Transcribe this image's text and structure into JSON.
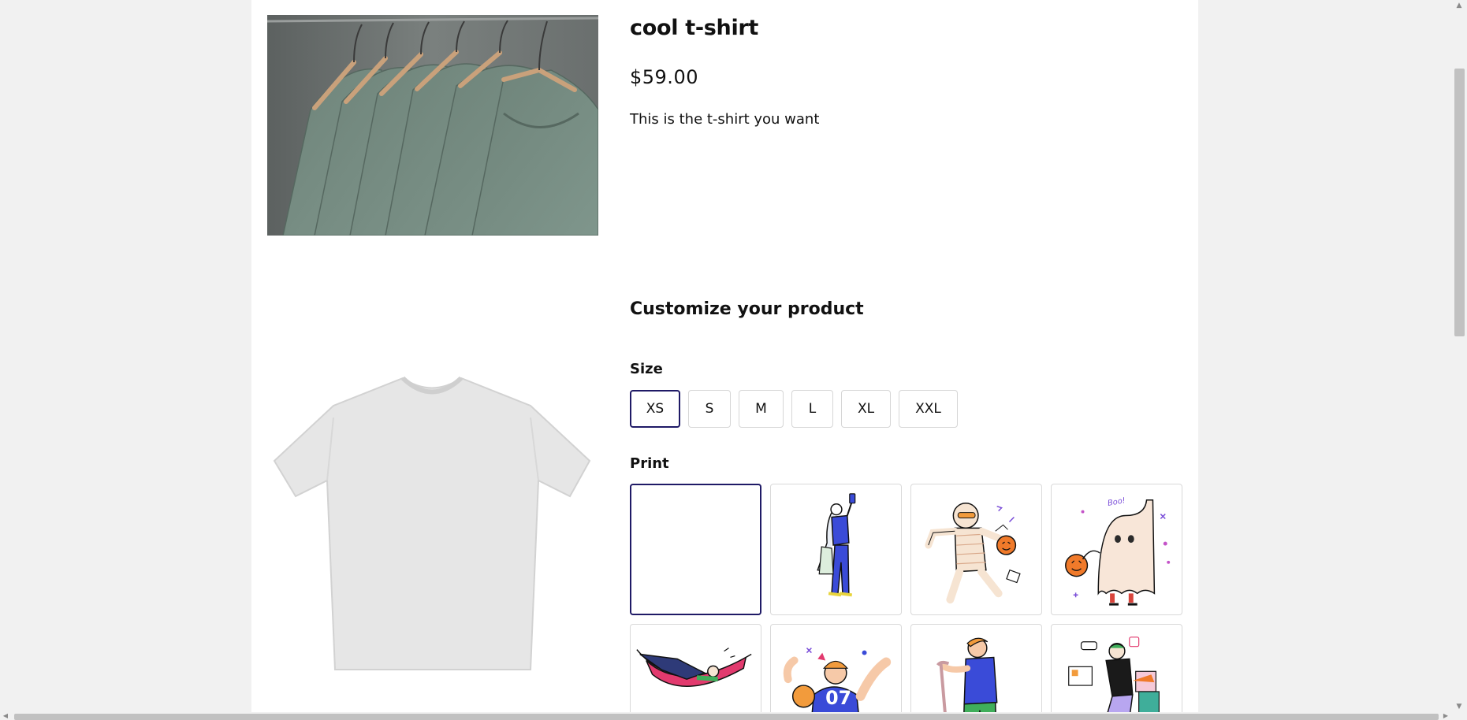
{
  "product": {
    "title": "cool t-shirt",
    "price": "$59.00",
    "description": "This is the t-shirt you want"
  },
  "customize": {
    "heading": "Customize your product",
    "size": {
      "label": "Size",
      "selected": "XS",
      "options": [
        "XS",
        "S",
        "M",
        "L",
        "XL",
        "XXL"
      ]
    },
    "print": {
      "label": "Print",
      "selected_index": 0,
      "ghost_text": "Boo!",
      "jersey_number": "07",
      "options": [
        {
          "icon": "blank-print-icon"
        },
        {
          "icon": "selfie-woman-print-icon"
        },
        {
          "icon": "mummy-halloween-print-icon"
        },
        {
          "icon": "ghost-halloween-print-icon"
        },
        {
          "icon": "hammock-relax-print-icon"
        },
        {
          "icon": "sports-fan-print-icon"
        },
        {
          "icon": "elderly-man-cane-print-icon"
        },
        {
          "icon": "delivery-cyclist-print-icon"
        }
      ]
    }
  },
  "colors": {
    "accent": "#1f1a66",
    "page_background": "#f1f1f1",
    "shirt_photo": "#72877f",
    "preview_shirt": "#e6e6e6"
  }
}
